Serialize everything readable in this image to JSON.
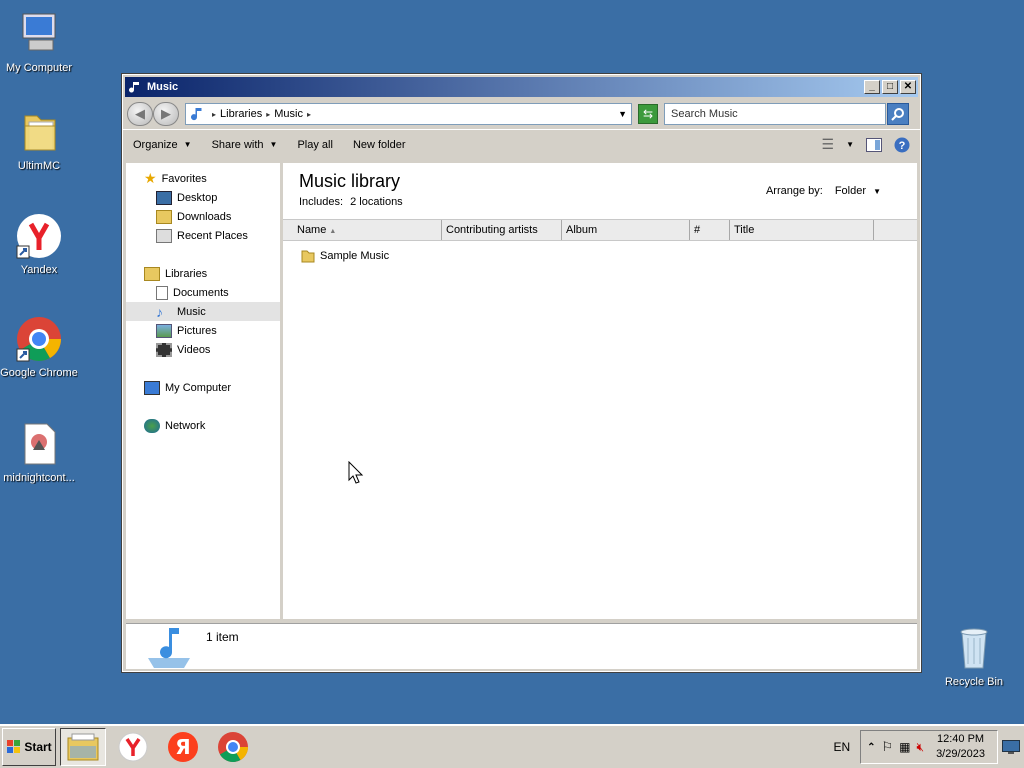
{
  "desktop": {
    "icons": [
      {
        "label": "My Computer"
      },
      {
        "label": "UltimMC"
      },
      {
        "label": "Yandex"
      },
      {
        "label": "Google Chrome"
      },
      {
        "label": "midnightcont..."
      },
      {
        "label": "Recycle Bin"
      }
    ]
  },
  "window": {
    "title": "Music",
    "address": {
      "crumb1": "Libraries",
      "crumb2": "Music"
    },
    "search_placeholder": "Search Music",
    "commands": {
      "organize": "Organize",
      "share": "Share with",
      "play_all": "Play all",
      "new_folder": "New folder"
    },
    "nav": {
      "favorites": "Favorites",
      "desktop": "Desktop",
      "downloads": "Downloads",
      "recent": "Recent Places",
      "libraries": "Libraries",
      "documents": "Documents",
      "music": "Music",
      "pictures": "Pictures",
      "videos": "Videos",
      "computer": "My Computer",
      "network": "Network"
    },
    "library": {
      "title": "Music library",
      "includes_label": "Includes:",
      "includes_value": "2 locations",
      "arrange_label": "Arrange by:",
      "arrange_value": "Folder"
    },
    "columns": [
      "Name",
      "Contributing artists",
      "Album",
      "#",
      "Title"
    ],
    "files": [
      {
        "name": "Sample Music"
      }
    ],
    "status": "1 item"
  },
  "taskbar": {
    "start": "Start",
    "lang": "EN",
    "time": "12:40 PM",
    "date": "3/29/2023"
  }
}
